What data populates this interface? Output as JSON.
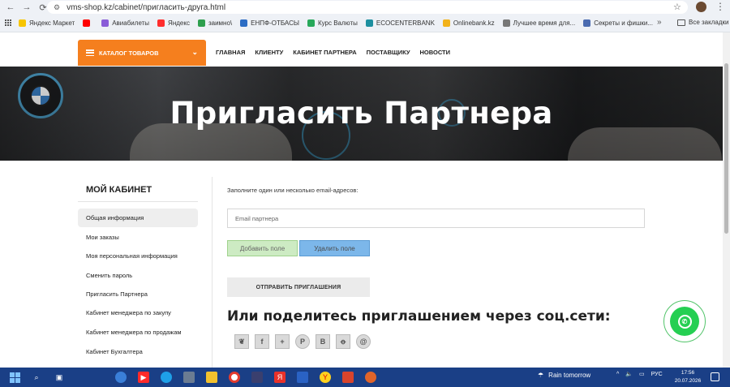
{
  "browser": {
    "url": "vms-shop.kz/cabinet/пригласить-друга.html",
    "bookmarks": [
      {
        "label": "Яндекс Маркет",
        "color": "#f7c500"
      },
      {
        "label": "",
        "color": "#ff0000"
      },
      {
        "label": "Авиабилеты",
        "color": "#8a5cd8"
      },
      {
        "label": "Яндекс",
        "color": "#ff2d2d"
      },
      {
        "label": "заимно\\",
        "color": "#2e9f4e"
      },
      {
        "label": "ЕНПФ-ОТБАСЫ",
        "color": "#2b6cc4"
      },
      {
        "label": "Курс Валюты",
        "color": "#27a85a"
      },
      {
        "label": "ECOCENTERBANK",
        "color": "#1d8f9f"
      },
      {
        "label": "Onlinebank.kz",
        "color": "#f2b21a"
      },
      {
        "label": "Лучшее время для...",
        "color": "#777777"
      },
      {
        "label": "Секреты и фишки...",
        "color": "#4b6bb0"
      }
    ],
    "more_symbol": "»",
    "all_bookmarks": "Все закладки"
  },
  "header": {
    "catalog_label": "КАТАЛОГ ТОВАРОВ",
    "menu": [
      "ГЛАВНАЯ",
      "КЛИЕНТУ",
      "КАБИНЕТ ПАРТНЕРА",
      "ПОСТАВЩИКУ",
      "НОВОСТИ"
    ]
  },
  "hero": {
    "title": "Пригласить Партнера"
  },
  "sidebar": {
    "title": "МОЙ КАБИНЕТ",
    "items": [
      {
        "label": "Общая информация",
        "active": true
      },
      {
        "label": "Мои заказы",
        "active": false
      },
      {
        "label": "Моя персональная информация",
        "active": false
      },
      {
        "label": "Сменить пароль",
        "active": false
      },
      {
        "label": "Пригласить Партнера",
        "active": false
      },
      {
        "label": "Кабинет менеджера по закупу",
        "active": false
      },
      {
        "label": "Кабинет менеджера по продажам",
        "active": false
      },
      {
        "label": "Кабинет Бухгалтера",
        "active": false
      }
    ]
  },
  "main": {
    "hint": "Заполните один или несколько email-адресов:",
    "email_placeholder": "Email партнера",
    "add_label": "Добавить поле",
    "delete_label": "Удалить поле",
    "send_label": "ОТПРАВИТЬ ПРИГЛАШЕНИЯ",
    "share_title": "Или поделитесь приглашением через соц.сети:",
    "socials": [
      {
        "icon": "twitter-icon",
        "glyph": "🐦"
      },
      {
        "icon": "facebook-icon",
        "glyph": "f"
      },
      {
        "icon": "google-plus-icon",
        "glyph": "+"
      },
      {
        "icon": "pinterest-icon",
        "glyph": "℗"
      },
      {
        "icon": "vk-icon",
        "glyph": "B"
      },
      {
        "icon": "odnoklassniki-icon",
        "glyph": "ok"
      },
      {
        "icon": "mail-icon",
        "glyph": "@"
      }
    ]
  },
  "taskbar": {
    "weather": "Rain tomorrow",
    "lang": "РУС",
    "time": "17:56",
    "date": "20.07.2026"
  },
  "colors": {
    "accent": "#f57f1e",
    "add_button": "#cdebc3",
    "delete_button": "#7cb7ea",
    "whatsapp": "#25cf52",
    "taskbar": "#1a3f86"
  }
}
